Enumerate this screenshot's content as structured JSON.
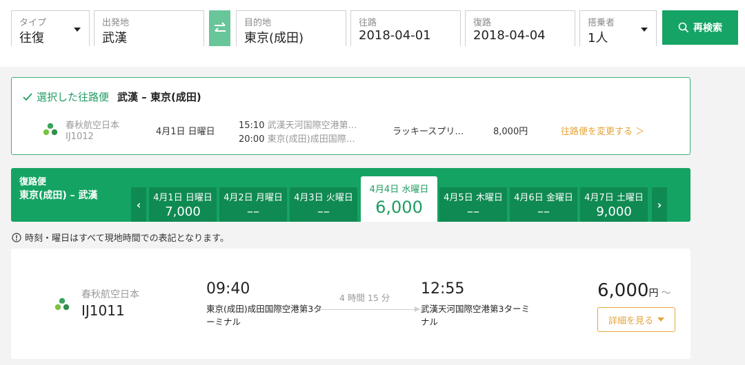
{
  "search": {
    "type_label": "タイプ",
    "type_value": "往復",
    "origin_label": "出発地",
    "origin_value": "武漢",
    "dest_label": "目的地",
    "dest_value": "東京(成田)",
    "depart_label": "往路",
    "depart_value": "2018-04-01",
    "return_label": "復路",
    "return_value": "2018-04-04",
    "pax_label": "搭乗者",
    "pax_value": "1人",
    "search_button": "再検索"
  },
  "selected_outbound": {
    "heading": "選択した往路便",
    "route": "武漢 – 東京(成田)",
    "airline": "春秋航空日本",
    "flight_no": "IJ1012",
    "date": "4月1日 日曜日",
    "dep_time": "15:10",
    "dep_airport": "武漢天河国際空港第…",
    "arr_time": "20:00",
    "arr_airport": "東京(成田)成田国際…",
    "fare": "ラッキースプリ…",
    "price": "8,000円",
    "change_link": "往路便を変更する ＞"
  },
  "return_strip": {
    "label": "復路便",
    "route": "東京(成田) – 武漢",
    "dates": [
      {
        "label": "4月1日 日曜日",
        "price": "7,000"
      },
      {
        "label": "4月2日 月曜日",
        "price": "––"
      },
      {
        "label": "4月3日 火曜日",
        "price": "––"
      },
      {
        "label": "4月4日 水曜日",
        "price": "6,000"
      },
      {
        "label": "4月5日 木曜日",
        "price": "––"
      },
      {
        "label": "4月6日 金曜日",
        "price": "––"
      },
      {
        "label": "4月7日 土曜日",
        "price": "9,000"
      }
    ]
  },
  "notice": "時刻・曜日はすべて現地時間での表記となります。",
  "result": {
    "airline": "春秋航空日本",
    "flight_no": "IJ1011",
    "dep_time": "09:40",
    "dep_airport": "東京(成田)成田国際空港第3ターミナル",
    "duration": "4 時間 15 分",
    "arr_time": "12:55",
    "arr_airport": "武漢天河国際空港第3ターミナル",
    "price": "6,000",
    "price_unit": "円",
    "price_suffix": "～",
    "detail_button": "詳細を見る"
  },
  "colors": {
    "brand_green": "#16a466",
    "accent_orange": "#e4a43a"
  }
}
